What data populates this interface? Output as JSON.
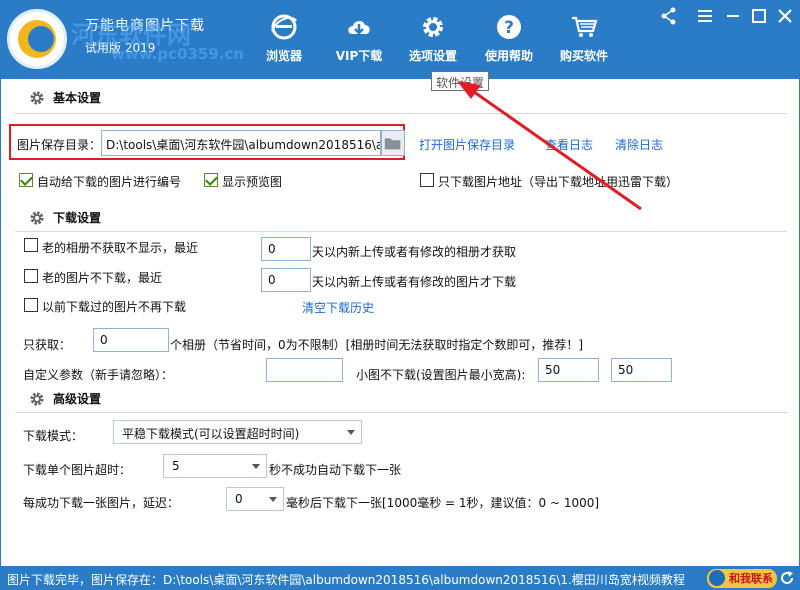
{
  "app": {
    "title": "万能电商图片下载",
    "version": "试用版  2019",
    "watermark": "河东软件网",
    "watermark_url": "www.pc0359.cn"
  },
  "toolbar": [
    {
      "label": "浏览器",
      "icon": "ie-browser-icon"
    },
    {
      "label": "VIP下载",
      "icon": "cloud-download-icon"
    },
    {
      "label": "选项设置",
      "icon": "gear-icon"
    },
    {
      "label": "使用帮助",
      "icon": "help-icon"
    },
    {
      "label": "购买软件",
      "icon": "shopping-cart-icon"
    }
  ],
  "tooltip": "软件设置",
  "basic": {
    "header": "基本设置",
    "save_dir_label": "图片保存目录：",
    "save_dir_value": "D:\\tools\\桌面\\河东软件园\\albumdown2018516\\alt",
    "open_dir_link": "打开图片保存目录",
    "view_log_link": "查看日志",
    "clear_log_link": "清除日志",
    "auto_number_label": "自动给下载的图片进行编号",
    "show_preview_label": "显示预览图",
    "only_address_label": "只下载图片地址（导出下载地址用迅雷下载）"
  },
  "download": {
    "header": "下载设置",
    "old_album_label": "老的相册不获取不显示，最近",
    "old_album_days": "0",
    "old_album_suffix": "天以内新上传或者有修改的相册才获取",
    "old_image_label": "老的图片不下载，最近",
    "old_image_days": "0",
    "old_image_suffix": "天以内新上传或者有修改的图片才下载",
    "no_redownload_label": "以前下载过的图片不再下载",
    "clear_history_link": "清空下载历史",
    "only_fetch_label": "只获取：",
    "only_fetch_value": "0",
    "only_fetch_suffix": "个相册（节省时间，0为不限制）[相册时间无法获取时指定个数即可，推荐！]",
    "custom_param_label": "自定义参数（新手请忽略）：",
    "custom_param_value": "",
    "min_size_label": "小图不下载(设置图片最小宽高):",
    "min_width": "50",
    "min_height": "50"
  },
  "advanced": {
    "header": "高级设置",
    "mode_label": "下载模式：",
    "mode_value": "平稳下载模式(可以设置超时时间)",
    "timeout_label": "下载单个图片超时：",
    "timeout_value": "5",
    "timeout_suffix": "秒不成功自动下载下一张",
    "delay_label": "每成功下载一张图片，延迟：",
    "delay_value": "0",
    "delay_suffix": "毫秒后下载下一张[1000毫秒 = 1秒，建议值：0 ~ 1000]"
  },
  "status": {
    "text": "图片下载完毕，图片保存在：D:\\tools\\桌面\\河东软件园\\albumdown2018516\\albumdown2018516\\1.樱田川岛宽松秋装",
    "video_tutorial": "视频教程",
    "contact": "和我联系"
  },
  "colors": {
    "brand": "#2b7cc7",
    "link": "#1b6ad8",
    "highlight": "#e21b24"
  }
}
